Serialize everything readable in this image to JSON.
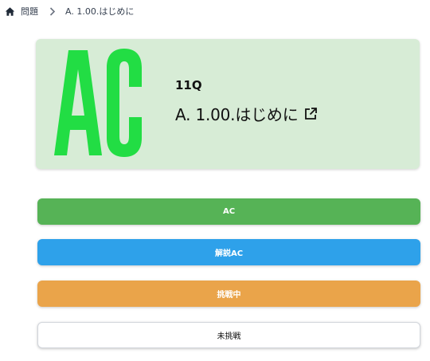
{
  "breadcrumb": {
    "home_icon": "home-icon",
    "root_label": "問題",
    "separator_icon": "chevron-right-icon",
    "current_label": "A. 1.00.はじめに"
  },
  "result": {
    "status_logo": "AC",
    "logo_color": "#22dd44",
    "card_color": "#d7ecd6",
    "level": "11Q",
    "title": "A. 1.00.はじめに",
    "external_link_icon": "external-link-icon"
  },
  "status_buttons": [
    {
      "label": "AC",
      "color": "#56b356"
    },
    {
      "label": "解説AC",
      "color": "#2ea1ea"
    },
    {
      "label": "挑戦中",
      "color": "#eaa44a"
    },
    {
      "label": "未挑戦",
      "color": "#ffffff"
    }
  ]
}
